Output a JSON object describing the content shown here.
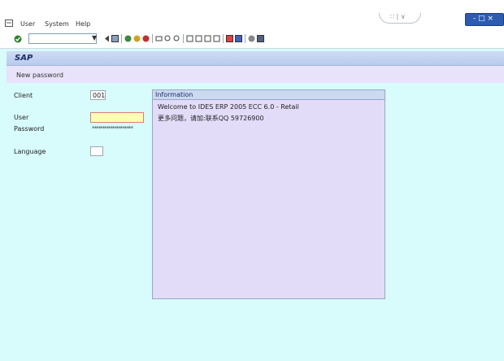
{
  "menu": {
    "items": [
      "User",
      "System",
      "Help"
    ],
    "window_controls_label": "- □ ×",
    "layout_controls_label": "∷ | ∨"
  },
  "toolbar": {
    "command_field_value": "",
    "dropdown_glyph": "▼"
  },
  "screen": {
    "title": "SAP",
    "app_toolbar_item": "New password"
  },
  "login": {
    "client_label": "Client",
    "client_value": "001",
    "user_label": "User",
    "user_value": "",
    "password_label": "Password",
    "password_value": "********************",
    "language_label": "Language",
    "language_value": ""
  },
  "information": {
    "header": "Information",
    "lines": [
      "Welcome to IDES ERP 2005 ECC 6.0 - Retail",
      "更多问题，请加:联系QQ 59726900"
    ]
  },
  "colors": {
    "background": "#d8fbfb",
    "title_bar": "#c4d4f0",
    "app_toolbar": "#e8e2fb",
    "info_box": "#e2dcf8",
    "user_field_highlight": "#ffffb4"
  }
}
